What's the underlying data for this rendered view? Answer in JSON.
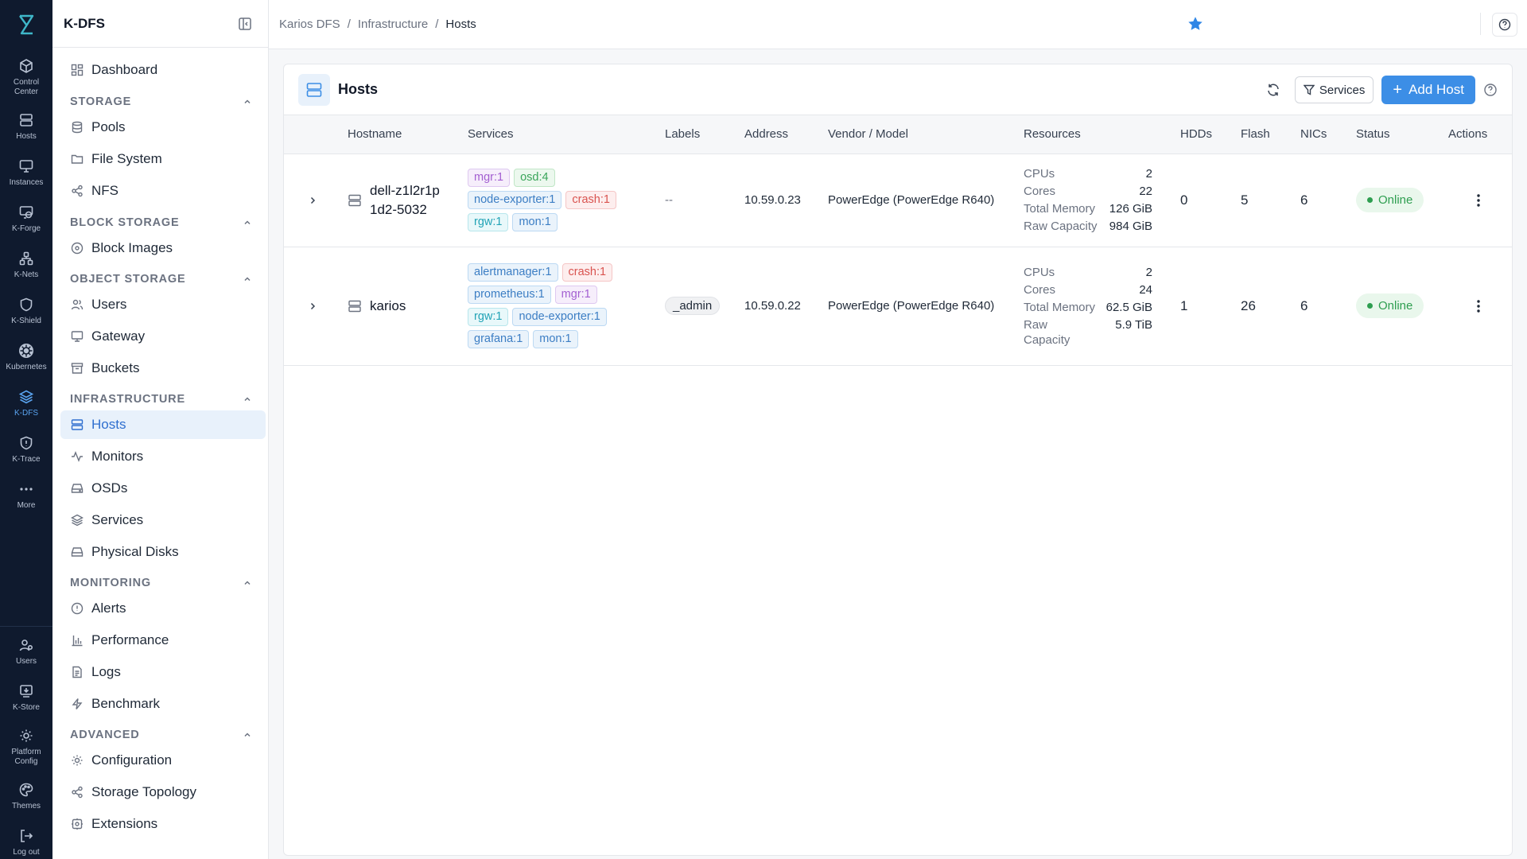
{
  "rail": {
    "logo": "k-dfs-logo",
    "items": [
      {
        "label": "Control Center",
        "icon": "cube-icon"
      },
      {
        "label": "Hosts",
        "icon": "server-icon"
      },
      {
        "label": "Instances",
        "icon": "monitor-icon"
      },
      {
        "label": "K-Forge",
        "icon": "forge-icon"
      },
      {
        "label": "K-Nets",
        "icon": "network-icon"
      },
      {
        "label": "K-Shield",
        "icon": "shield-icon"
      },
      {
        "label": "Kubernetes",
        "icon": "kubernetes-icon"
      },
      {
        "label": "K-DFS",
        "icon": "layers-icon"
      },
      {
        "label": "K-Trace",
        "icon": "trace-icon"
      },
      {
        "label": "More",
        "icon": "more-icon"
      },
      {
        "label": "Users",
        "icon": "users-icon"
      },
      {
        "label": "K-Store",
        "icon": "store-icon"
      },
      {
        "label": "Platform Config",
        "icon": "gear-icon"
      },
      {
        "label": "Themes",
        "icon": "palette-icon"
      },
      {
        "label": "Log out",
        "icon": "logout-icon"
      }
    ]
  },
  "sidebar": {
    "title": "K-DFS",
    "dashboard": "Dashboard",
    "sections": [
      {
        "title": "STORAGE",
        "items": [
          "Pools",
          "File System",
          "NFS"
        ]
      },
      {
        "title": "BLOCK STORAGE",
        "items": [
          "Block Images"
        ]
      },
      {
        "title": "OBJECT STORAGE",
        "items": [
          "Users",
          "Gateway",
          "Buckets"
        ]
      },
      {
        "title": "INFRASTRUCTURE",
        "items": [
          "Hosts",
          "Monitors",
          "OSDs",
          "Services",
          "Physical Disks"
        ]
      },
      {
        "title": "MONITORING",
        "items": [
          "Alerts",
          "Performance",
          "Logs",
          "Benchmark"
        ]
      },
      {
        "title": "ADVANCED",
        "items": [
          "Configuration",
          "Storage Topology",
          "Extensions"
        ]
      }
    ]
  },
  "breadcrumb": [
    "Karios DFS",
    "Infrastructure",
    "Hosts"
  ],
  "panel": {
    "title": "Hosts",
    "filter_label": "Services",
    "add_label": "Add Host"
  },
  "table": {
    "columns": [
      "Hostname",
      "Services",
      "Labels",
      "Address",
      "Vendor / Model",
      "Resources",
      "HDDs",
      "Flash",
      "NICs",
      "Status",
      "Actions"
    ],
    "rows": [
      {
        "hostname": "dell-z1l2r1p1d2-5032",
        "services": [
          "mgr:1",
          "osd:4",
          "node-exporter:1",
          "crash:1",
          "rgw:1",
          "mon:1"
        ],
        "labels": "--",
        "address": "10.59.0.23",
        "vendor": "PowerEdge (PowerEdge R640)",
        "resources": {
          "cpus": "2",
          "cores": "22",
          "memory": "126 GiB",
          "capacity": "984 GiB"
        },
        "hdds": "0",
        "flash": "5",
        "nics": "6",
        "status": "Online"
      },
      {
        "hostname": "karios",
        "services": [
          "alertmanager:1",
          "crash:1",
          "prometheus:1",
          "mgr:1",
          "rgw:1",
          "node-exporter:1",
          "grafana:1",
          "mon:1"
        ],
        "labels": "_admin",
        "address": "10.59.0.22",
        "vendor": "PowerEdge (PowerEdge R640)",
        "resources": {
          "cpus": "2",
          "cores": "24",
          "memory": "62.5 GiB",
          "capacity": "5.9 TiB"
        },
        "hdds": "1",
        "flash": "26",
        "nics": "6",
        "status": "Online"
      }
    ],
    "resource_keys": {
      "cpus": "CPUs",
      "cores": "Cores",
      "memory": "Total Memory",
      "capacity": "Raw Capacity"
    }
  },
  "colors": {
    "rail_bg": "#0f1a2e",
    "accent": "#3c8ee6",
    "online": "#2e9e50",
    "star": "#2f86e6"
  }
}
